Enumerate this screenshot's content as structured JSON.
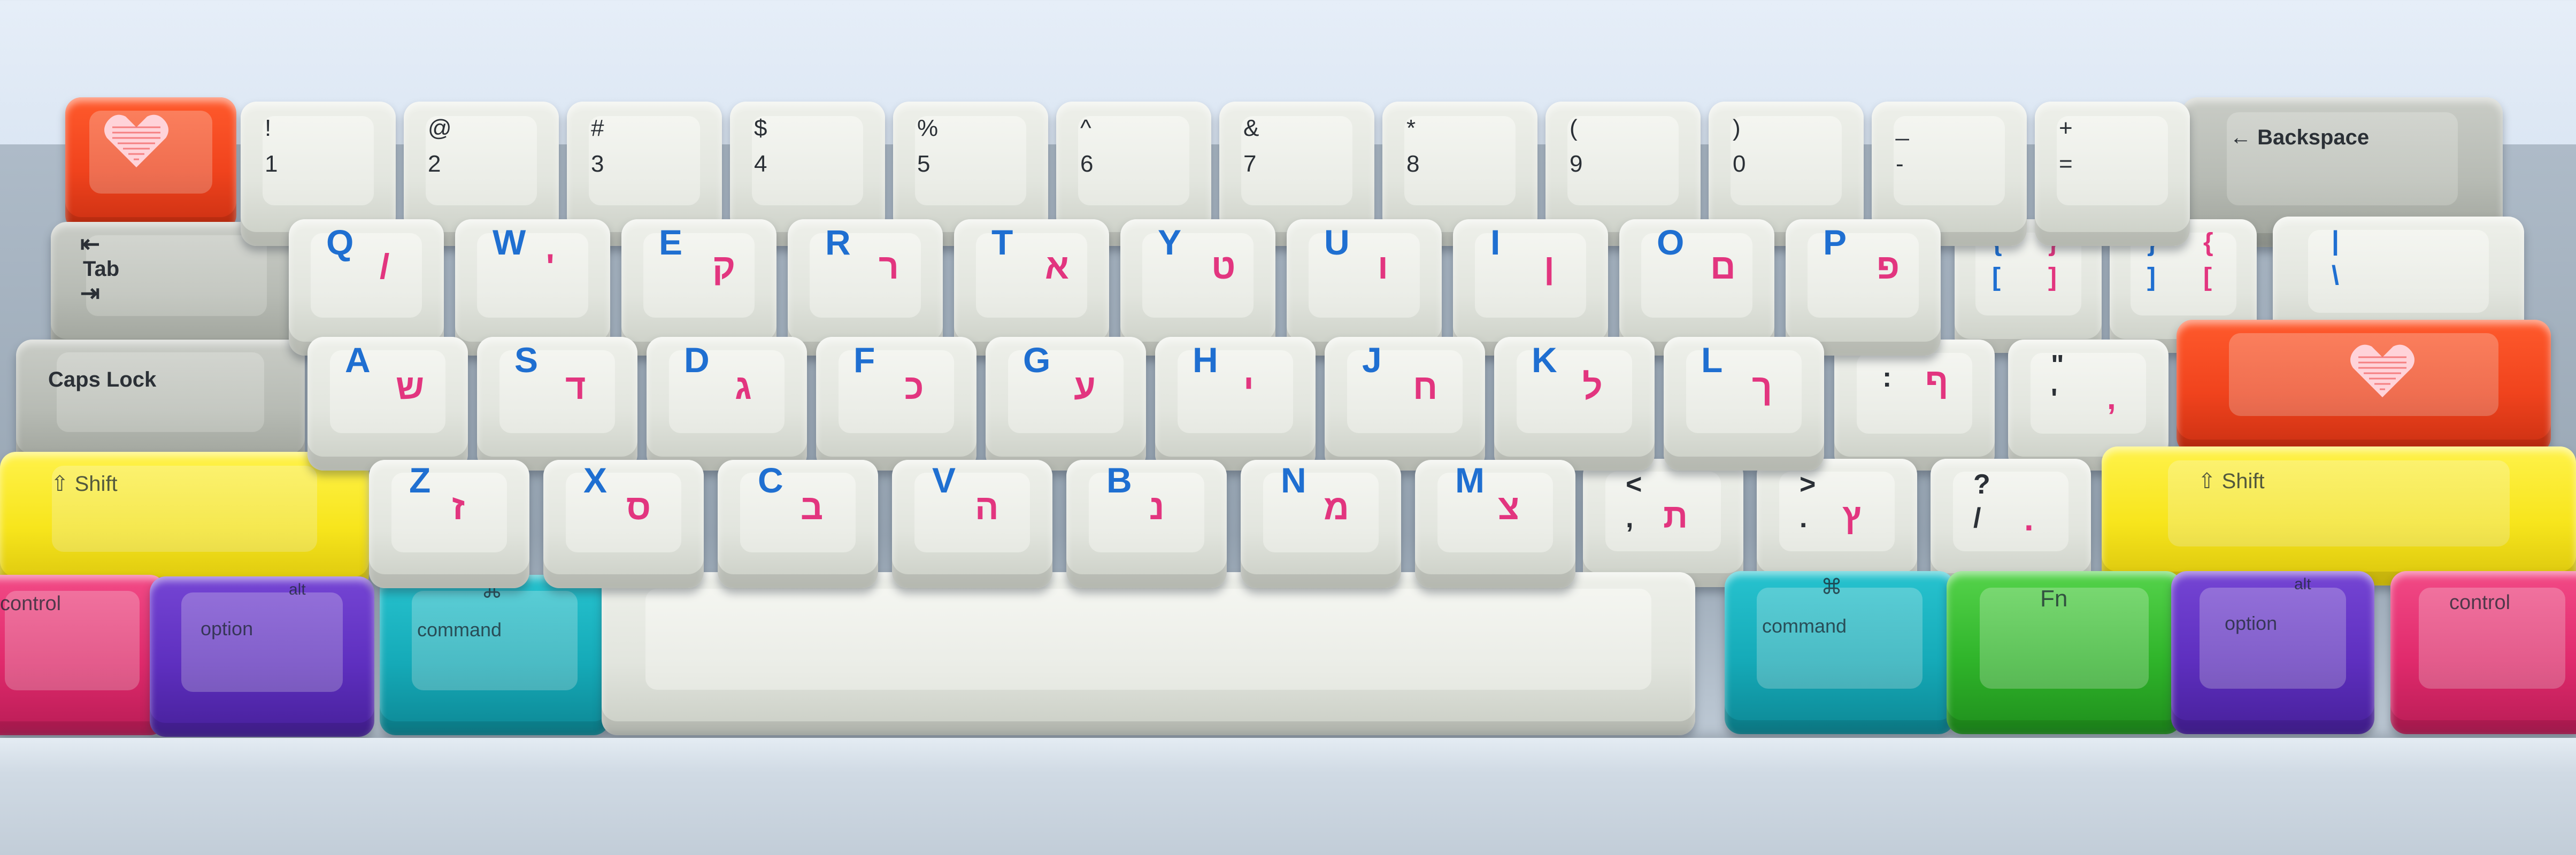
{
  "keyboard": {
    "number_row": [
      {
        "top": "!",
        "bottom": "1"
      },
      {
        "top": "@",
        "bottom": "2"
      },
      {
        "top": "#",
        "bottom": "3"
      },
      {
        "top": "$",
        "bottom": "4"
      },
      {
        "top": "%",
        "bottom": "5"
      },
      {
        "top": "^",
        "bottom": "6"
      },
      {
        "top": "&",
        "bottom": "7"
      },
      {
        "top": "*",
        "bottom": "8"
      },
      {
        "top": "(",
        "bottom": "9"
      },
      {
        "top": ")",
        "bottom": "0"
      },
      {
        "top": "_",
        "bottom": "-"
      },
      {
        "top": "+",
        "bottom": "="
      }
    ],
    "backspace_label": "← Backspace",
    "tab_arrows_top": "⇤",
    "tab_label": "Tab",
    "tab_arrows_bottom": "⇥",
    "qwerty_row": [
      {
        "latin": "Q",
        "hebrew": "/"
      },
      {
        "latin": "W",
        "hebrew": "'"
      },
      {
        "latin": "E",
        "hebrew": "ק"
      },
      {
        "latin": "R",
        "hebrew": "ר"
      },
      {
        "latin": "T",
        "hebrew": "א"
      },
      {
        "latin": "Y",
        "hebrew": "ט"
      },
      {
        "latin": "U",
        "hebrew": "ו"
      },
      {
        "latin": "I",
        "hebrew": "ן"
      },
      {
        "latin": "O",
        "hebrew": "ם"
      },
      {
        "latin": "P",
        "hebrew": "פ"
      }
    ],
    "bracket_left": {
      "tl": "{",
      "tr": "}",
      "bl": "[",
      "br": "]"
    },
    "bracket_right": {
      "tl": "}",
      "tr": "{",
      "bl": "]",
      "br": "["
    },
    "backslash": {
      "top": "|",
      "bottom": "\\"
    },
    "caps_label": "Caps Lock",
    "home_row": [
      {
        "latin": "A",
        "hebrew": "ש"
      },
      {
        "latin": "S",
        "hebrew": "ד"
      },
      {
        "latin": "D",
        "hebrew": "ג"
      },
      {
        "latin": "F",
        "hebrew": "כ"
      },
      {
        "latin": "G",
        "hebrew": "ע"
      },
      {
        "latin": "H",
        "hebrew": "י"
      },
      {
        "latin": "J",
        "hebrew": "ח"
      },
      {
        "latin": "K",
        "hebrew": "ל"
      },
      {
        "latin": "L",
        "hebrew": "ך"
      }
    ],
    "semicolon": {
      "top": ":",
      "hebrew": "ף"
    },
    "quote": {
      "top": "\"",
      "bottom": "'",
      "hebrew": ","
    },
    "shift_label": "⇧ Shift",
    "bottom_alpha_row": [
      {
        "latin": "Z",
        "hebrew": "ז"
      },
      {
        "latin": "X",
        "hebrew": "ס"
      },
      {
        "latin": "C",
        "hebrew": "ב"
      },
      {
        "latin": "V",
        "hebrew": "ה"
      },
      {
        "latin": "B",
        "hebrew": "נ"
      },
      {
        "latin": "N",
        "hebrew": "מ"
      },
      {
        "latin": "M",
        "hebrew": "צ"
      }
    ],
    "comma": {
      "top": "<",
      "bottom": ",",
      "hebrew": "ת"
    },
    "period": {
      "top": ">",
      "bottom": ".",
      "hebrew": "ץ"
    },
    "slash": {
      "top": "?",
      "bottom": "/",
      "hebrew": "."
    },
    "control_label": "control",
    "option_alt": "alt",
    "option_label": "option",
    "command_symbol": "⌘",
    "command_label": "command",
    "fn_label": "Fn",
    "colors": {
      "red": "#f0431d",
      "yellow": "#f7e51c",
      "pink": "#e02a6c",
      "purple": "#5e2fbf",
      "teal": "#15aab8",
      "green": "#2fb42a",
      "keycap": "#e2e5de",
      "latin_legend": "#1f6fd1",
      "hebrew_legend": "#e2357f"
    },
    "icons": [
      "heart-icon",
      "shift-arrow-icon",
      "command-icon",
      "tab-arrow-icon"
    ]
  }
}
